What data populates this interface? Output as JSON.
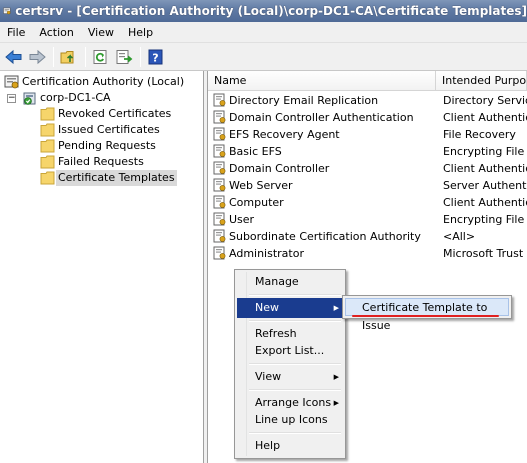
{
  "window": {
    "title": "certsrv - [Certification Authority (Local)\\corp-DC1-CA\\Certificate Templates]"
  },
  "menu": {
    "file": "File",
    "action": "Action",
    "view": "View",
    "help": "Help"
  },
  "toolbar": {
    "icons": [
      "back-arrow-icon",
      "forward-arrow-icon",
      "up-folder-icon",
      "refresh-icon",
      "export-list-icon",
      "help-icon"
    ]
  },
  "tree": {
    "root": "Certification Authority (Local)",
    "ca": "corp-DC1-CA",
    "nodes": [
      {
        "label": "Revoked Certificates"
      },
      {
        "label": "Issued Certificates"
      },
      {
        "label": "Pending Requests"
      },
      {
        "label": "Failed Requests"
      },
      {
        "label": "Certificate Templates"
      }
    ]
  },
  "list": {
    "columns": [
      "Name",
      "Intended Purpose"
    ],
    "rows": [
      {
        "name": "Directory Email Replication",
        "purpose": "Directory Service"
      },
      {
        "name": "Domain Controller Authentication",
        "purpose": "Client Authenticat"
      },
      {
        "name": "EFS Recovery Agent",
        "purpose": "File Recovery"
      },
      {
        "name": "Basic EFS",
        "purpose": "Encrypting File Sy"
      },
      {
        "name": "Domain Controller",
        "purpose": "Client Authenticat"
      },
      {
        "name": "Web Server",
        "purpose": "Server Authentica"
      },
      {
        "name": "Computer",
        "purpose": "Client Authenticat"
      },
      {
        "name": "User",
        "purpose": "Encrypting File Sy"
      },
      {
        "name": "Subordinate Certification Authority",
        "purpose": "<All>"
      },
      {
        "name": "Administrator",
        "purpose": "Microsoft Trust Lis"
      }
    ]
  },
  "context_menu": {
    "manage": "Manage",
    "new": "New",
    "refresh": "Refresh",
    "export_list": "Export List...",
    "view": "View",
    "arrange_icons": "Arrange Icons",
    "line_up_icons": "Line up Icons",
    "help": "Help"
  },
  "submenu": {
    "item": "Certificate Template to Issue"
  },
  "colors": {
    "menu_highlight": "#1a3c8f",
    "annotation_underline": "#e02020",
    "titlebar": "#5f7aa4"
  }
}
